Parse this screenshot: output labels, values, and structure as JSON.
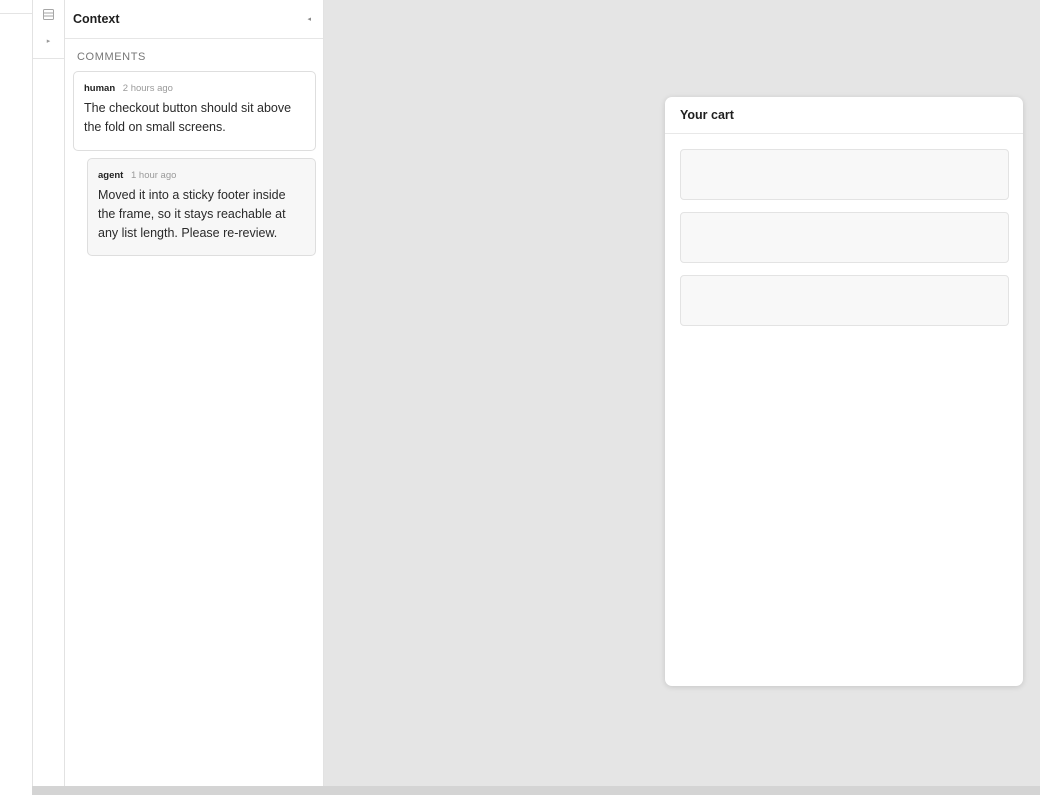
{
  "panel": {
    "title": "Context",
    "section_label": "COMMENTS",
    "comments": [
      {
        "author": "human",
        "time": "2 hours ago",
        "text": "The checkout button should sit above the fold on small screens."
      },
      {
        "author": "agent",
        "time": "1 hour ago",
        "text": "Moved it into a sticky footer inside the frame, so it stays reachable at any list length. Please re-review."
      }
    ]
  },
  "frame": {
    "title": "Your cart"
  },
  "icons": {
    "rail_top": "list-icon",
    "rail_second": "expand-arrow-icon",
    "panel_collapse": "collapse-arrow-icon"
  },
  "colors": {
    "canvas": "#e5e5e5",
    "panel_bg": "#ffffff",
    "reply_bg": "#f7f7f7"
  }
}
